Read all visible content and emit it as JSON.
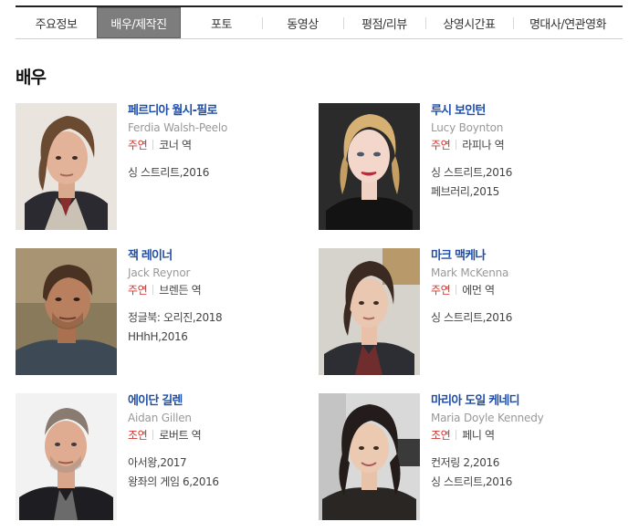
{
  "tabs": [
    {
      "label": "주요정보",
      "active": false
    },
    {
      "label": "배우/제작진",
      "active": true
    },
    {
      "label": "포토",
      "active": false
    },
    {
      "label": "동영상",
      "active": false
    },
    {
      "label": "평점/리뷰",
      "active": false
    },
    {
      "label": "상영시간표",
      "active": false
    },
    {
      "label": "명대사/연관영화",
      "active": false
    }
  ],
  "section_title": "배우",
  "actors": [
    {
      "name_ko": "페르디아 월시-필로",
      "name_en": "Ferdia Walsh-Peelo",
      "role": "주연",
      "character": "코너 역",
      "films": [
        "싱 스트리트,2016"
      ]
    },
    {
      "name_ko": "루시 보인턴",
      "name_en": "Lucy Boynton",
      "role": "주연",
      "character": "라피나 역",
      "films": [
        "싱 스트리트,2016",
        "페브러리,2015"
      ]
    },
    {
      "name_ko": "잭 레이너",
      "name_en": "Jack Reynor",
      "role": "주연",
      "character": "브렌든 역",
      "films": [
        "정글북: 오리진,2018",
        "HHhH,2016"
      ]
    },
    {
      "name_ko": "마크 맥케나",
      "name_en": "Mark McKenna",
      "role": "주연",
      "character": "에먼 역",
      "films": [
        "싱 스트리트,2016"
      ]
    },
    {
      "name_ko": "에이단 길렌",
      "name_en": "Aidan Gillen",
      "role": "조연",
      "character": "로버트 역",
      "films": [
        "아서왕,2017",
        "왕좌의 게임 6,2016"
      ]
    },
    {
      "name_ko": "마리아 도일 케네디",
      "name_en": "Maria Doyle Kennedy",
      "role": "조연",
      "character": "페니 역",
      "films": [
        "컨저링 2,2016",
        "싱 스트리트,2016"
      ]
    }
  ]
}
